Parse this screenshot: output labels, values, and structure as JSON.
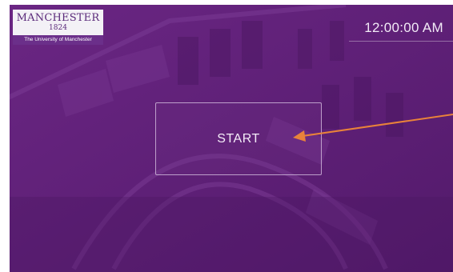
{
  "logo": {
    "wordmark": "MANCHESTER",
    "year": "1824",
    "subtitle": "The University of Manchester"
  },
  "clock": {
    "time": "12:00:00 AM"
  },
  "start_button": {
    "label": "START"
  },
  "colors": {
    "background": "#5f1f78",
    "logo_band": "#6b2f8a",
    "annotation_arrow": "#e8823a"
  },
  "icons": {
    "annotation": "arrow-pointer-icon"
  }
}
